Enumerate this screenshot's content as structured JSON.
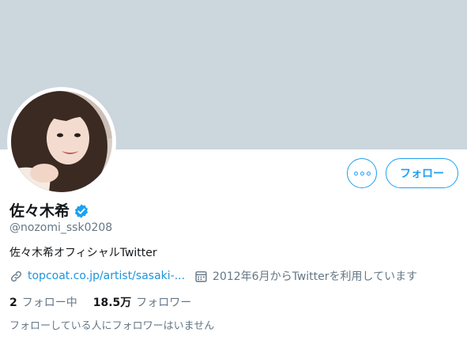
{
  "profile": {
    "display_name": "佐々木希",
    "handle": "@nozomi_ssk0208",
    "bio": "佐々木希オフィシャルTwitter",
    "website": "topcoat.co.jp/artist/sasaki-...",
    "joined": "2012年6月からTwitterを利用しています",
    "verified_icon": "verified-badge-icon",
    "avatar_icon": "profile-photo"
  },
  "actions": {
    "more_icon": "more-options-icon",
    "follow_label": "フォロー"
  },
  "stats": {
    "following_count": "2",
    "following_label": "フォロー中",
    "followers_count": "18.5万",
    "followers_label": "フォロワー"
  },
  "followers_you_know": "フォローしている人にフォロワーはいません",
  "colors": {
    "banner": "#ccd6dd",
    "accent": "#1da1f2",
    "link": "#1b95e0",
    "secondary_text": "#657786"
  }
}
